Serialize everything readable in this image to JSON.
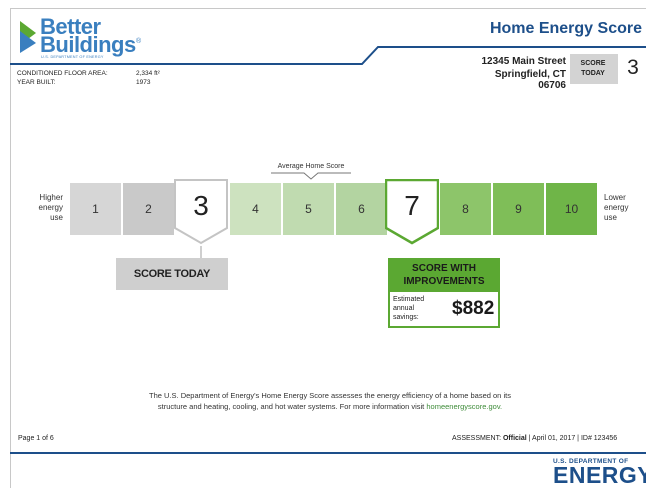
{
  "header": {
    "logo_line1": "Better",
    "logo_line2": "Buildings",
    "logo_reg": "®",
    "logo_sub": "U.S. DEPARTMENT OF ENERGY",
    "title": "Home Energy Score",
    "address_street": "12345 Main Street",
    "address_city": "Springfield, CT 06706",
    "score_label": "SCORE TODAY",
    "score_value": "3"
  },
  "property": {
    "floor_area_label": "CONDITIONED FLOOR AREA:",
    "floor_area_value": "2,334 ft²",
    "year_built_label": "YEAR BUILT:",
    "year_built_value": "1973"
  },
  "scale": {
    "left_label": [
      "Higher",
      "energy",
      "use"
    ],
    "right_label": [
      "Lower",
      "energy",
      "use"
    ],
    "average_label": "Average Home Score",
    "cells": [
      "1",
      "2",
      "3",
      "4",
      "5",
      "6",
      "7",
      "8",
      "9",
      "10"
    ],
    "current_score": "3",
    "improved_score": "7",
    "colors": {
      "gray_light": "#d6d6d6",
      "gray_mid": "#c4c4c4",
      "green_pale_1": "#cde2bf",
      "green_pale_2": "#c0dbb0",
      "green_pale_3": "#b3d4a1",
      "green_1": "#8dc56a",
      "green_2": "#7fbe58",
      "green_3": "#6fb548",
      "accent_green": "#5ba832"
    }
  },
  "score_today": {
    "label": "SCORE TODAY"
  },
  "improvements": {
    "title_line1": "SCORE WITH",
    "title_line2": "IMPROVEMENTS",
    "savings_line1": "Estimated",
    "savings_line2": "annual",
    "savings_line3": "savings:",
    "savings_value": "$882"
  },
  "description": {
    "text_line1": "The U.S. Department of Energy's Home Energy Score assesses the energy efficiency of a home based on its",
    "text_line2": "structure and heating, cooling, and hot water systems. For more information visit ",
    "link": "homeenergyscore.gov."
  },
  "footer": {
    "page": "Page 1 of 6",
    "assessment_label": "ASSESSMENT:",
    "assessment_value": "Official",
    "date": "| April 01, 2017 | ID# 123456",
    "doe_sub": "U.S. DEPARTMENT OF",
    "doe_main": "ENERGY"
  }
}
